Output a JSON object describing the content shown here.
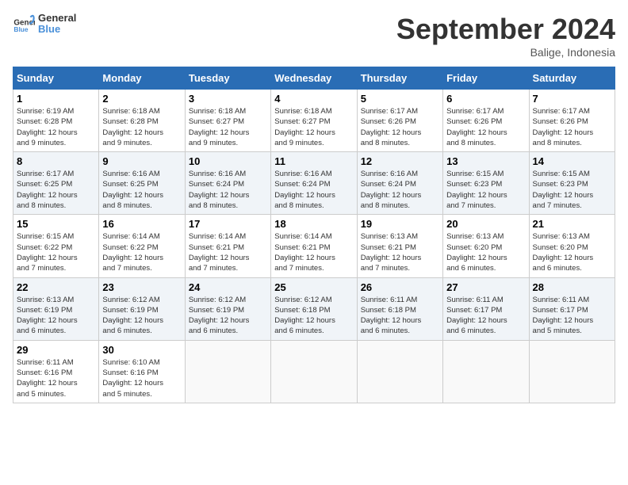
{
  "header": {
    "logo_general": "General",
    "logo_blue": "Blue",
    "month_title": "September 2024",
    "location": "Balige, Indonesia"
  },
  "days_of_week": [
    "Sunday",
    "Monday",
    "Tuesday",
    "Wednesday",
    "Thursday",
    "Friday",
    "Saturday"
  ],
  "weeks": [
    [
      {
        "day": "1",
        "sunrise": "6:19 AM",
        "sunset": "6:28 PM",
        "daylight": "12 hours and 9 minutes."
      },
      {
        "day": "2",
        "sunrise": "6:18 AM",
        "sunset": "6:28 PM",
        "daylight": "12 hours and 9 minutes."
      },
      {
        "day": "3",
        "sunrise": "6:18 AM",
        "sunset": "6:27 PM",
        "daylight": "12 hours and 9 minutes."
      },
      {
        "day": "4",
        "sunrise": "6:18 AM",
        "sunset": "6:27 PM",
        "daylight": "12 hours and 9 minutes."
      },
      {
        "day": "5",
        "sunrise": "6:17 AM",
        "sunset": "6:26 PM",
        "daylight": "12 hours and 8 minutes."
      },
      {
        "day": "6",
        "sunrise": "6:17 AM",
        "sunset": "6:26 PM",
        "daylight": "12 hours and 8 minutes."
      },
      {
        "day": "7",
        "sunrise": "6:17 AM",
        "sunset": "6:26 PM",
        "daylight": "12 hours and 8 minutes."
      }
    ],
    [
      {
        "day": "8",
        "sunrise": "6:17 AM",
        "sunset": "6:25 PM",
        "daylight": "12 hours and 8 minutes."
      },
      {
        "day": "9",
        "sunrise": "6:16 AM",
        "sunset": "6:25 PM",
        "daylight": "12 hours and 8 minutes."
      },
      {
        "day": "10",
        "sunrise": "6:16 AM",
        "sunset": "6:24 PM",
        "daylight": "12 hours and 8 minutes."
      },
      {
        "day": "11",
        "sunrise": "6:16 AM",
        "sunset": "6:24 PM",
        "daylight": "12 hours and 8 minutes."
      },
      {
        "day": "12",
        "sunrise": "6:16 AM",
        "sunset": "6:24 PM",
        "daylight": "12 hours and 8 minutes."
      },
      {
        "day": "13",
        "sunrise": "6:15 AM",
        "sunset": "6:23 PM",
        "daylight": "12 hours and 7 minutes."
      },
      {
        "day": "14",
        "sunrise": "6:15 AM",
        "sunset": "6:23 PM",
        "daylight": "12 hours and 7 minutes."
      }
    ],
    [
      {
        "day": "15",
        "sunrise": "6:15 AM",
        "sunset": "6:22 PM",
        "daylight": "12 hours and 7 minutes."
      },
      {
        "day": "16",
        "sunrise": "6:14 AM",
        "sunset": "6:22 PM",
        "daylight": "12 hours and 7 minutes."
      },
      {
        "day": "17",
        "sunrise": "6:14 AM",
        "sunset": "6:21 PM",
        "daylight": "12 hours and 7 minutes."
      },
      {
        "day": "18",
        "sunrise": "6:14 AM",
        "sunset": "6:21 PM",
        "daylight": "12 hours and 7 minutes."
      },
      {
        "day": "19",
        "sunrise": "6:13 AM",
        "sunset": "6:21 PM",
        "daylight": "12 hours and 7 minutes."
      },
      {
        "day": "20",
        "sunrise": "6:13 AM",
        "sunset": "6:20 PM",
        "daylight": "12 hours and 6 minutes."
      },
      {
        "day": "21",
        "sunrise": "6:13 AM",
        "sunset": "6:20 PM",
        "daylight": "12 hours and 6 minutes."
      }
    ],
    [
      {
        "day": "22",
        "sunrise": "6:13 AM",
        "sunset": "6:19 PM",
        "daylight": "12 hours and 6 minutes."
      },
      {
        "day": "23",
        "sunrise": "6:12 AM",
        "sunset": "6:19 PM",
        "daylight": "12 hours and 6 minutes."
      },
      {
        "day": "24",
        "sunrise": "6:12 AM",
        "sunset": "6:19 PM",
        "daylight": "12 hours and 6 minutes."
      },
      {
        "day": "25",
        "sunrise": "6:12 AM",
        "sunset": "6:18 PM",
        "daylight": "12 hours and 6 minutes."
      },
      {
        "day": "26",
        "sunrise": "6:11 AM",
        "sunset": "6:18 PM",
        "daylight": "12 hours and 6 minutes."
      },
      {
        "day": "27",
        "sunrise": "6:11 AM",
        "sunset": "6:17 PM",
        "daylight": "12 hours and 6 minutes."
      },
      {
        "day": "28",
        "sunrise": "6:11 AM",
        "sunset": "6:17 PM",
        "daylight": "12 hours and 5 minutes."
      }
    ],
    [
      {
        "day": "29",
        "sunrise": "6:11 AM",
        "sunset": "6:16 PM",
        "daylight": "12 hours and 5 minutes."
      },
      {
        "day": "30",
        "sunrise": "6:10 AM",
        "sunset": "6:16 PM",
        "daylight": "12 hours and 5 minutes."
      },
      null,
      null,
      null,
      null,
      null
    ]
  ]
}
